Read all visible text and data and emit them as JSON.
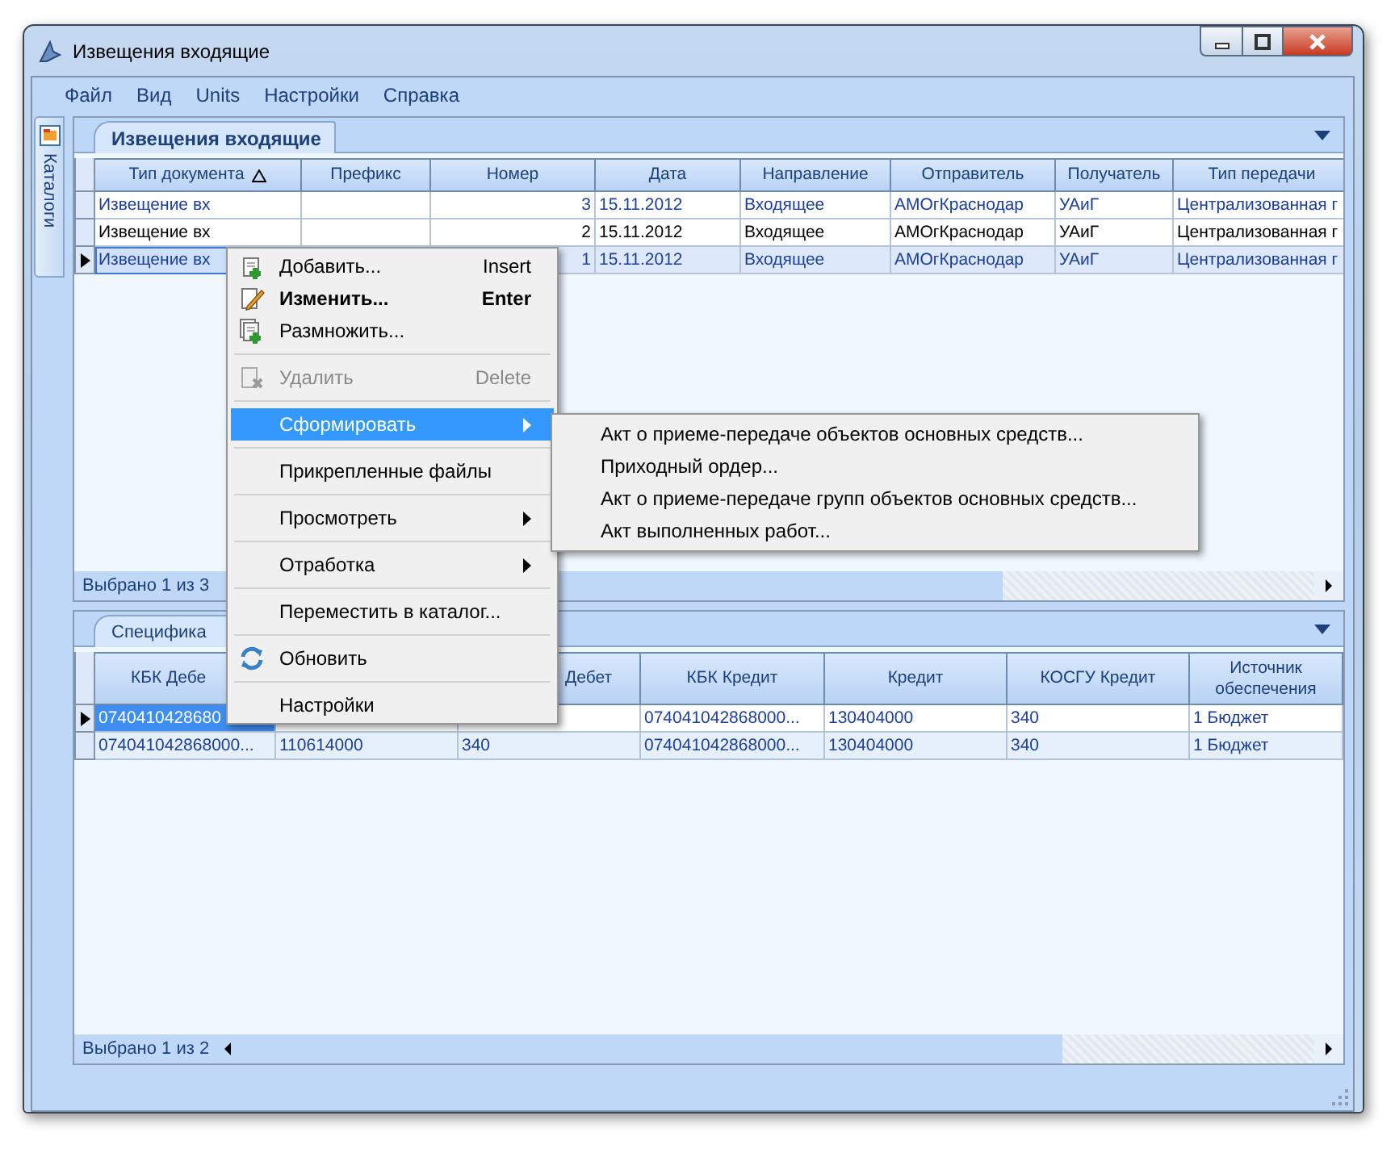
{
  "window": {
    "title": "Извещения входящие"
  },
  "menu": [
    "Файл",
    "Вид",
    "Units",
    "Настройки",
    "Справка"
  ],
  "side_tab": {
    "label": "Каталоги"
  },
  "upper_panel": {
    "tab": "Извещения входящие",
    "columns": [
      {
        "label": "Тип документа",
        "sorted": true
      },
      {
        "label": "Префикс",
        "sorted": false
      },
      {
        "label": "Номер",
        "sorted": false
      },
      {
        "label": "Дата",
        "sorted": false
      },
      {
        "label": "Направление",
        "sorted": false
      },
      {
        "label": "Отправитель",
        "sorted": false
      },
      {
        "label": "Получатель",
        "sorted": false
      },
      {
        "label": "Тип передачи",
        "sorted": false
      }
    ],
    "rows": [
      {
        "selected": false,
        "highlighted": true,
        "doc_type": "Извещение вх",
        "number": "3",
        "date": "15.11.2012",
        "direction": "Входящее",
        "sender": "АМОгКраснодар",
        "recipient": "УАиГ",
        "transfer_type": "Централизованная г"
      },
      {
        "selected": false,
        "highlighted": false,
        "doc_type": "Извещение вх",
        "number": "2",
        "date": "15.11.2012",
        "direction": "Входящее",
        "sender": "АМОгКраснодар",
        "recipient": "УАиГ",
        "transfer_type": "Централизованная г"
      },
      {
        "selected": true,
        "highlighted": true,
        "doc_type": "Извещение вх",
        "number": "1",
        "date": "15.11.2012",
        "direction": "Входящее",
        "sender": "АМОгКраснодар",
        "recipient": "УАиГ",
        "transfer_type": "Централизованная г"
      }
    ],
    "status": "Выбрано 1 из 3"
  },
  "lower_panel": {
    "tab": "Специфика",
    "columns": {
      "kbk_debit": "КБК Дебе",
      "column_3": "Дебет",
      "kbk_credit": "КБК Кредит",
      "credit": "Кредит",
      "kosgu_credit": "КОСГУ Кредит",
      "source": "Источник обеспечения"
    },
    "rows": [
      {
        "selected": true,
        "kbk_debit": "0740410428680",
        "kbk_credit": "074041042868000...",
        "credit": "130404000",
        "kosgu_credit": "340",
        "source": "1 Бюджет"
      },
      {
        "selected": false,
        "kbk_debit": "074041042868000...",
        "column_2": "110614000",
        "column_3": "340",
        "kbk_credit": "074041042868000...",
        "credit": "130404000",
        "kosgu_credit": "340",
        "source": "1 Бюджет"
      }
    ],
    "status": "Выбрано 1 из 2"
  },
  "context_menu": [
    {
      "kind": "item",
      "label": "Добавить...",
      "shortcut": "Insert",
      "bold": false,
      "disabled": false,
      "selected": false,
      "submenu": false
    },
    {
      "kind": "item",
      "label": "Изменить...",
      "shortcut": "Enter",
      "bold": true,
      "disabled": false,
      "selected": false,
      "submenu": false
    },
    {
      "kind": "item",
      "label": "Размножить...",
      "bold": false,
      "disabled": false,
      "selected": false,
      "submenu": false
    },
    {
      "kind": "separator"
    },
    {
      "kind": "item",
      "label": "Удалить",
      "shortcut": "Delete",
      "bold": false,
      "disabled": true,
      "selected": false,
      "submenu": false
    },
    {
      "kind": "separator"
    },
    {
      "kind": "item",
      "label": "Сформировать",
      "bold": false,
      "disabled": false,
      "selected": true,
      "submenu": true
    },
    {
      "kind": "separator"
    },
    {
      "kind": "item",
      "label": "Прикрепленные файлы",
      "bold": false,
      "disabled": false,
      "selected": false,
      "submenu": false
    },
    {
      "kind": "separator"
    },
    {
      "kind": "item",
      "label": "Просмотреть",
      "bold": false,
      "disabled": false,
      "selected": false,
      "submenu": true
    },
    {
      "kind": "separator"
    },
    {
      "kind": "item",
      "label": "Отработка",
      "bold": false,
      "disabled": false,
      "selected": false,
      "submenu": true
    },
    {
      "kind": "separator"
    },
    {
      "kind": "item",
      "label": "Переместить в каталог...",
      "bold": false,
      "disabled": false,
      "selected": false,
      "submenu": false
    },
    {
      "kind": "separator"
    },
    {
      "kind": "item",
      "label": "Обновить",
      "bold": false,
      "disabled": false,
      "selected": false,
      "submenu": false
    },
    {
      "kind": "separator"
    },
    {
      "kind": "item",
      "label": "Настройки",
      "bold": false,
      "disabled": false,
      "selected": false,
      "submenu": false
    }
  ],
  "submenu": [
    "Акт о приеме-передаче объектов основных средств...",
    "Приходный ордер...",
    "Акт о приеме-передаче групп объектов основных средств...",
    "Акт выполненных работ..."
  ]
}
